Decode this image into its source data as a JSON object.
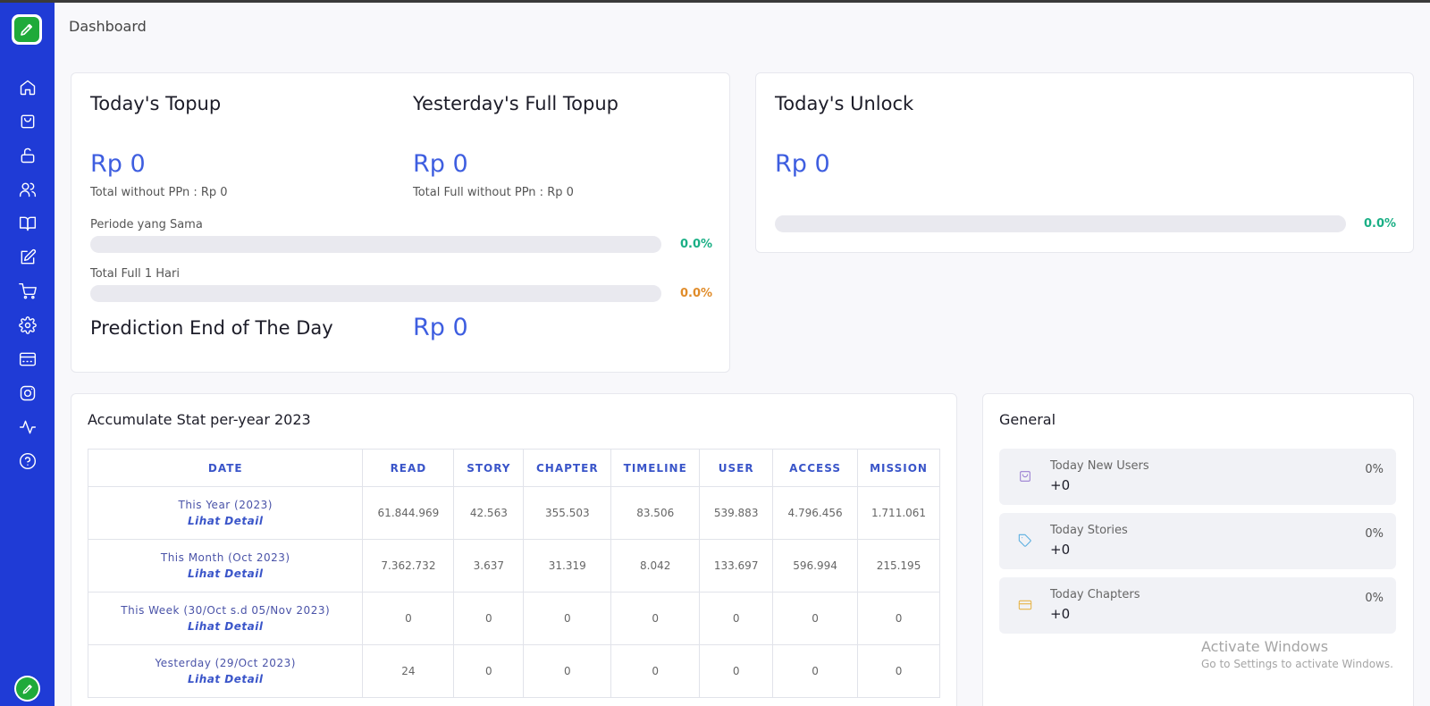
{
  "page": {
    "title": "Dashboard"
  },
  "sidebar": {
    "items": [
      {
        "icon": "home-icon"
      },
      {
        "icon": "shopping-bag-icon"
      },
      {
        "icon": "unlock-icon"
      },
      {
        "icon": "users-icon"
      },
      {
        "icon": "book-open-icon"
      },
      {
        "icon": "edit-icon"
      },
      {
        "icon": "cart-icon"
      },
      {
        "icon": "settings-icon"
      },
      {
        "icon": "card-layout-icon"
      },
      {
        "icon": "instagram-icon"
      },
      {
        "icon": "activity-icon"
      },
      {
        "icon": "help-icon"
      }
    ]
  },
  "topup": {
    "today_title": "Today's Topup",
    "today_value": "Rp 0",
    "today_sub": "Total without PPn : Rp 0",
    "yesterday_title": "Yesterday's Full Topup",
    "yesterday_value": "Rp 0",
    "yesterday_sub": "Total Full without PPn : Rp 0",
    "periode_label": "Periode yang Sama",
    "periode_pct": "0.0%",
    "periode_fill": 0,
    "full_label": "Total Full 1 Hari",
    "full_pct": "0.0%",
    "full_fill": 0,
    "prediction_title": "Prediction End of The Day",
    "prediction_value": "Rp 0"
  },
  "unlock": {
    "title": "Today's Unlock",
    "value": "Rp 0",
    "pct": "0.0%",
    "fill": 0
  },
  "accumulate": {
    "title": "Accumulate Stat per-year 2023",
    "columns": [
      "DATE",
      "READ",
      "STORY",
      "CHAPTER",
      "TIMELINE",
      "USER",
      "ACCESS",
      "MISSION"
    ],
    "rows": [
      {
        "date": "This Year (2023)",
        "link": "Lihat Detail",
        "values": [
          "61.844.969",
          "42.563",
          "355.503",
          "83.506",
          "539.883",
          "4.796.456",
          "1.711.061"
        ]
      },
      {
        "date": "This Month (Oct 2023)",
        "link": "Lihat Detail",
        "values": [
          "7.362.732",
          "3.637",
          "31.319",
          "8.042",
          "133.697",
          "596.994",
          "215.195"
        ]
      },
      {
        "date": "This Week (30/Oct s.d 05/Nov 2023)",
        "link": "Lihat Detail",
        "values": [
          "0",
          "0",
          "0",
          "0",
          "0",
          "0",
          "0"
        ]
      },
      {
        "date": "Yesterday (29/Oct 2023)",
        "link": "Lihat Detail",
        "values": [
          "24",
          "0",
          "0",
          "0",
          "0",
          "0",
          "0"
        ]
      }
    ]
  },
  "general": {
    "title": "General",
    "items": [
      {
        "label": "Today New Users",
        "value": "+0",
        "pct": "0%",
        "icon": "bag-icon",
        "color": "#9a7fd1"
      },
      {
        "label": "Today Stories",
        "value": "+0",
        "pct": "0%",
        "icon": "tag-icon",
        "color": "#5aaee0"
      },
      {
        "label": "Today Chapters",
        "value": "+0",
        "pct": "0%",
        "icon": "card-icon",
        "color": "#e7b54a"
      }
    ]
  },
  "watermark": {
    "line1": "Activate Windows",
    "line2": "Go to Settings to activate Windows."
  },
  "colors": {
    "sidebar": "#1f3bd6",
    "accent": "#3e5ee0",
    "green": "#1aaf85",
    "orange": "#e08c2a"
  }
}
